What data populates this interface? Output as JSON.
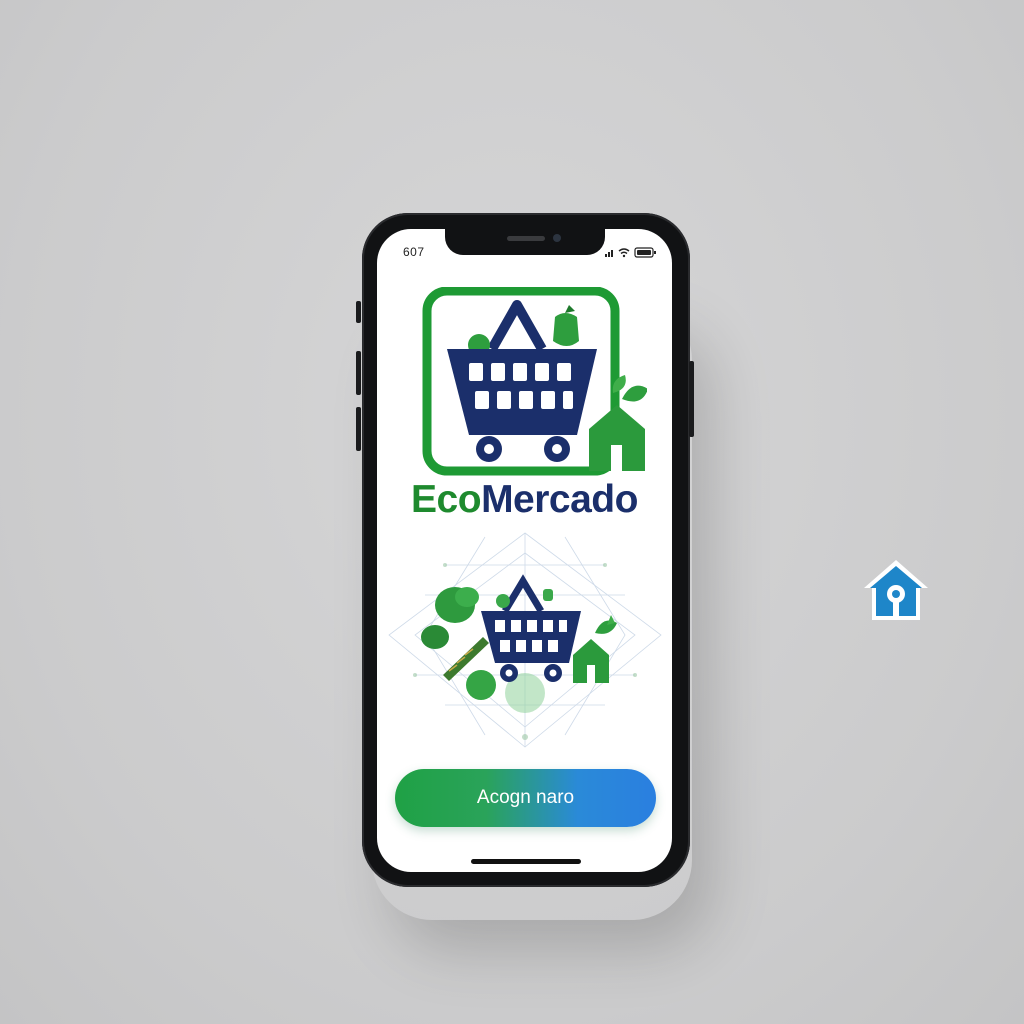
{
  "status_bar": {
    "time": "607",
    "icons": [
      "signal-icon",
      "wifi-icon",
      "battery-icon"
    ]
  },
  "app": {
    "logo_icon": "shopping-basket-logo-icon",
    "brand_part1": "Eco",
    "brand_part2": "Mercado",
    "illustration_icon": "grocery-basket-illustration-icon",
    "cta_label": "Acogn naro"
  },
  "floating": {
    "icon": "home-location-icon"
  },
  "colors": {
    "brand_green": "#1e8a2e",
    "brand_navy": "#1b2f6b",
    "cta_start": "#1fa145",
    "cta_end": "#2a7fe0",
    "floating_icon_blue": "#1e86c9"
  }
}
